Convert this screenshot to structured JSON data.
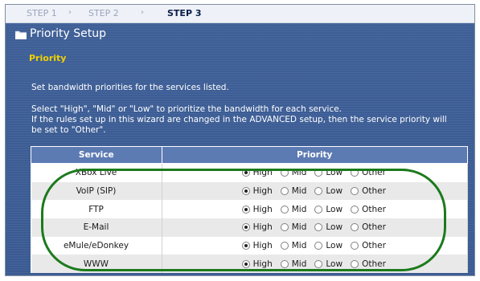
{
  "wizard": {
    "steps": [
      "STEP 1",
      "STEP 2",
      "STEP 3"
    ],
    "title": "Priority Setup",
    "section_label": "Priority",
    "intro": "Set bandwidth priorities for the services listed.",
    "instruction_1": "Select \"High\", \"Mid\" or \"Low\" to prioritize the bandwidth for each service.",
    "instruction_2": "If the rules set up in this wizard are changed in the ADVANCED setup, then the service priority will",
    "instruction_3": "be set to \"Other\"."
  },
  "table": {
    "headers": [
      "Service",
      "Priority"
    ],
    "options": [
      "High",
      "Mid",
      "Low",
      "Other"
    ],
    "rows": [
      {
        "service": "XBox Live",
        "selected": "High"
      },
      {
        "service": "VoIP (SIP)",
        "selected": "High"
      },
      {
        "service": "FTP",
        "selected": "High"
      },
      {
        "service": "E-Mail",
        "selected": "High"
      },
      {
        "service": "eMule/eDonkey",
        "selected": "High"
      },
      {
        "service": "WWW",
        "selected": "High"
      }
    ]
  },
  "colors": {
    "highlight_ring": "#1c7a1c",
    "section_label": "#f0d000",
    "header_bg": "#5d7bb3"
  },
  "icons": {
    "title": "folder-icon"
  }
}
